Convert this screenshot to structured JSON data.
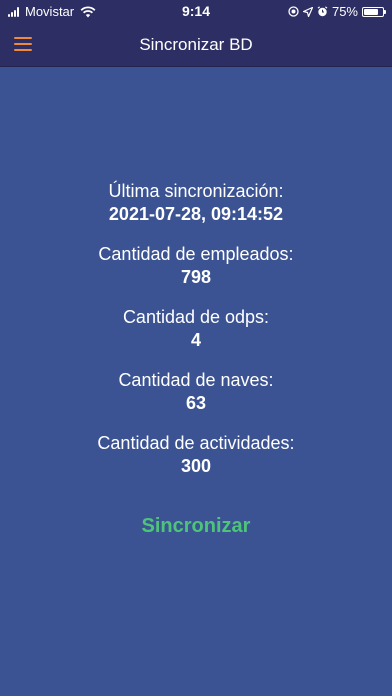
{
  "status_bar": {
    "carrier": "Movistar",
    "time": "9:14",
    "battery_percent": "75%",
    "battery_level": 0.75,
    "icons": [
      "signal-icon",
      "wifi-icon",
      "screen-record-icon",
      "location-icon",
      "alarm-icon"
    ]
  },
  "header": {
    "title": "Sincronizar BD",
    "menu_icon": "hamburger-menu-icon",
    "accent_color": "#f0893a"
  },
  "stats": [
    {
      "label": "Última sincronización:",
      "value": "2021-07-28, 09:14:52"
    },
    {
      "label": "Cantidad de empleados:",
      "value": "798"
    },
    {
      "label": "Cantidad de odps:",
      "value": "4"
    },
    {
      "label": "Cantidad de naves:",
      "value": "63"
    },
    {
      "label": "Cantidad de actividades:",
      "value": "300"
    }
  ],
  "actions": {
    "sync_label": "Sincronizar",
    "sync_color": "#4ec37a"
  },
  "colors": {
    "background": "#3b5393",
    "header_background": "#2d2e63"
  }
}
